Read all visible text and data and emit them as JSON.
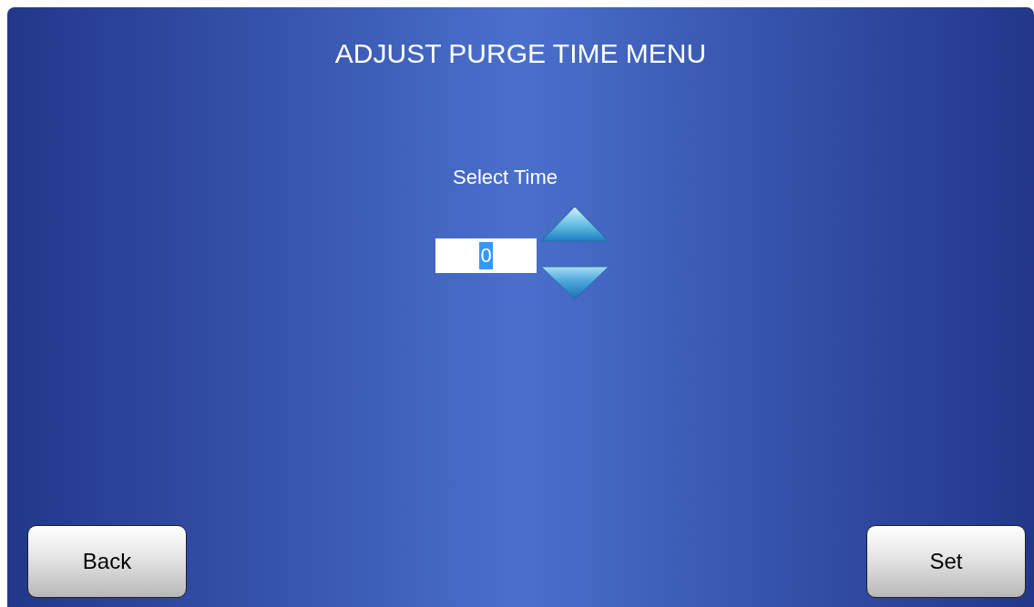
{
  "title": "ADJUST PURGE TIME MENU",
  "time_selector": {
    "label": "Select Time",
    "value": "0",
    "value_selected": true
  },
  "buttons": [
    {
      "label": "Back"
    },
    {
      "label": "Set"
    }
  ]
}
